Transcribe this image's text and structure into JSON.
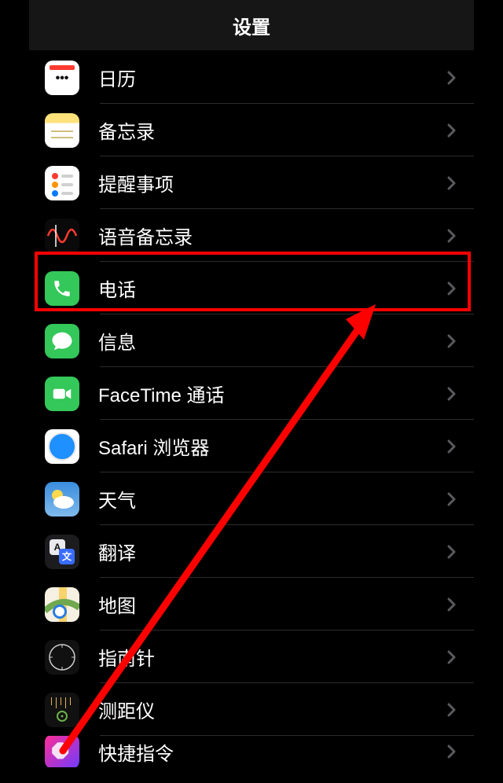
{
  "header": {
    "title": "设置"
  },
  "items": [
    {
      "label": "日历",
      "icon": "calendar"
    },
    {
      "label": "备忘录",
      "icon": "notes"
    },
    {
      "label": "提醒事项",
      "icon": "reminders"
    },
    {
      "label": "语音备忘录",
      "icon": "voice-memos"
    },
    {
      "label": "电话",
      "icon": "phone",
      "highlighted": true
    },
    {
      "label": "信息",
      "icon": "messages"
    },
    {
      "label": "FaceTime 通话",
      "icon": "facetime"
    },
    {
      "label": "Safari 浏览器",
      "icon": "safari"
    },
    {
      "label": "天气",
      "icon": "weather"
    },
    {
      "label": "翻译",
      "icon": "translate"
    },
    {
      "label": "地图",
      "icon": "maps"
    },
    {
      "label": "指南针",
      "icon": "compass"
    },
    {
      "label": "测距仪",
      "icon": "measure"
    },
    {
      "label": "快捷指令",
      "icon": "shortcuts",
      "partial": true
    }
  ],
  "annotation": {
    "highlight_color": "#ff0000",
    "arrow_color": "#ff0000"
  }
}
